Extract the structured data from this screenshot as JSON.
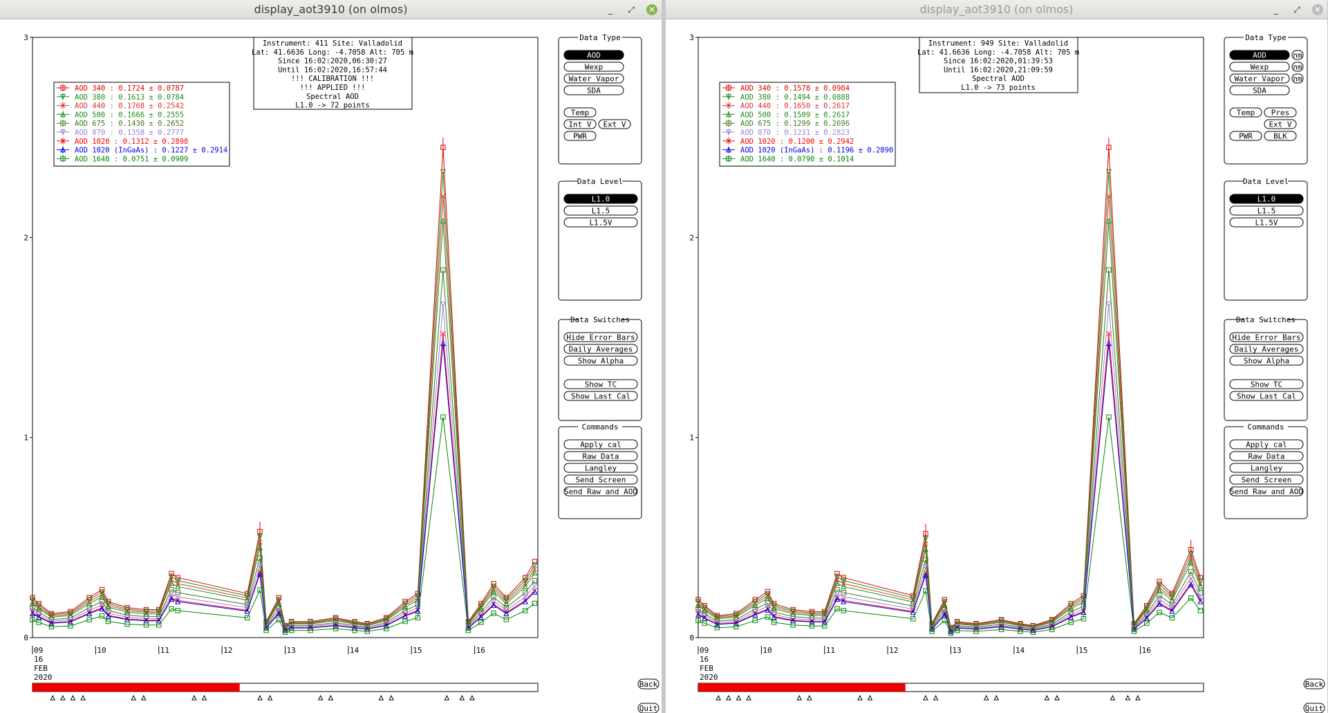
{
  "windows": [
    {
      "title": "display_aot3910 (on olmos)",
      "controls": {
        "minimize": "_",
        "maximize": "⤢",
        "close": "✕"
      },
      "info": [
        "Instrument: 411 Site: Valladolid",
        "Lat: 41.6636 Long: -4.7058 Alt: 705 m",
        "Since 16:02:2020,06:30:27",
        "Until 16:02:2020,16:57:44",
        "!!! CALIBRATION !!!",
        "!!!   APPLIED   !!!",
        "Spectral AOD",
        "L1.0 -> 72 points"
      ],
      "legend": [
        {
          "label": "AOD 340   : 0.1724 ± 0.0787",
          "color": "#e00000",
          "marker": "square"
        },
        {
          "label": "AOD 380   : 0.1613 ± 0.0784",
          "color": "#1a8c1a",
          "marker": "tri-down"
        },
        {
          "label": "AOD 440   : 0.1768 ± 0.2542",
          "color": "#e03030",
          "marker": "x"
        },
        {
          "label": "AOD 500   : 0.1666 ± 0.2555",
          "color": "#1a8c1a",
          "marker": "tri-up"
        },
        {
          "label": "AOD 675   : 0.1430 ± 0.2652",
          "color": "#3c7a1a",
          "marker": "square"
        },
        {
          "label": "AOD 870   : 0.1358 ± 0.2777",
          "color": "#9a80e0",
          "marker": "tri-down"
        },
        {
          "label": "AOD 1020  : 0.1312 ± 0.2898",
          "color": "#ff0000",
          "marker": "x"
        },
        {
          "label": "AOD 1020 (InGaAs)  : 0.1227 ± 0.2914",
          "color": "#0000ee",
          "marker": "tri-up"
        },
        {
          "label": "AOD 1640  : 0.0751 ± 0.0909",
          "color": "#008800",
          "marker": "square"
        }
      ],
      "y_ticks": [
        "3",
        "2",
        "1",
        "0"
      ],
      "x_ticks": [
        "09",
        "10",
        "11",
        "12",
        "13",
        "14",
        "15",
        "16"
      ],
      "date_lines": [
        "16",
        "FEB",
        "2020"
      ],
      "panels": [
        {
          "title": "Data Type",
          "buttons": [
            {
              "label": "AOD",
              "selected": true
            },
            {
              "label": "Wexp"
            },
            {
              "label": "Water Vapor"
            },
            {
              "label": "SDA"
            },
            {
              "label": "Temp"
            },
            {
              "label": "Int V"
            },
            {
              "label": "Ext V"
            },
            {
              "label": "PWR"
            }
          ]
        },
        {
          "title": "Data Level",
          "buttons": [
            {
              "label": "L1.0",
              "selected": true
            },
            {
              "label": "L1.5"
            },
            {
              "label": "L1.5V"
            }
          ]
        },
        {
          "title": "Data Switches",
          "buttons": [
            {
              "label": "Hide Error Bars"
            },
            {
              "label": "Daily Averages"
            },
            {
              "label": "Show Alpha"
            },
            {
              "label": "Show TC"
            },
            {
              "label": "Show Last Cal"
            }
          ]
        },
        {
          "title": "Commands",
          "buttons": [
            {
              "label": "Apply cal"
            },
            {
              "label": "Raw Data"
            },
            {
              "label": "Langley"
            },
            {
              "label": "Send Screen"
            },
            {
              "label": "Send Raw and AOD"
            }
          ]
        }
      ],
      "back_label": "Back",
      "quit_label": "Quit",
      "progress": 0.41
    },
    {
      "title": "display_aot3910 (on olmos)",
      "controls": {
        "minimize": "_",
        "maximize": "⤢",
        "close": "✕"
      },
      "info": [
        "Instrument: 949 Site: Valladolid",
        "Lat: 41.6636 Long: -4.7058 Alt: 705 m",
        "Since 16:02:2020,01:39:53",
        "Until 16:02:2020,21:09:59",
        "Spectral AOD",
        "L1.0 -> 73 points"
      ],
      "legend": [
        {
          "label": "AOD 340   : 0.1578 ± 0.0904",
          "color": "#e00000",
          "marker": "square"
        },
        {
          "label": "AOD 380   : 0.1494 ± 0.0888",
          "color": "#1a8c1a",
          "marker": "tri-down"
        },
        {
          "label": "AOD 440   : 0.1650 ± 0.2617",
          "color": "#e03030",
          "marker": "x"
        },
        {
          "label": "AOD 500   : 0.1509 ± 0.2617",
          "color": "#1a8c1a",
          "marker": "tri-up"
        },
        {
          "label": "AOD 675   : 0.1299 ± 0.2696",
          "color": "#3c7a1a",
          "marker": "square"
        },
        {
          "label": "AOD 870   : 0.1231 ± 0.2823",
          "color": "#9a80e0",
          "marker": "tri-down"
        },
        {
          "label": "AOD 1020  : 0.1200 ± 0.2942",
          "color": "#ff0000",
          "marker": "x"
        },
        {
          "label": "AOD 1020 (InGaAs)  : 0.1196 ± 0.2890",
          "color": "#0000ee",
          "marker": "tri-up"
        },
        {
          "label": "AOD 1640  : 0.0790 ± 0.1014",
          "color": "#008800",
          "marker": "square"
        }
      ],
      "y_ticks": [
        "3",
        "2",
        "1",
        "0"
      ],
      "x_ticks": [
        "09",
        "10",
        "11",
        "12",
        "13",
        "14",
        "15",
        "16"
      ],
      "date_lines": [
        "16",
        "FEB",
        "2020"
      ],
      "panels": [
        {
          "title": "Data Type",
          "buttons": [
            {
              "label": "AOD",
              "selected": true
            },
            {
              "label": "nm"
            },
            {
              "label": "Wexp"
            },
            {
              "label": "nm"
            },
            {
              "label": "Water Vapor"
            },
            {
              "label": "nm"
            },
            {
              "label": "SDA"
            },
            {
              "label": "Temp"
            },
            {
              "label": "Pres"
            },
            {
              "label": "Ext V"
            },
            {
              "label": "PWR"
            },
            {
              "label": "BLK"
            }
          ]
        },
        {
          "title": "Data Level",
          "buttons": [
            {
              "label": "L1.0",
              "selected": true
            },
            {
              "label": "L1.5"
            },
            {
              "label": "L1.5V"
            }
          ]
        },
        {
          "title": "Data Switches",
          "buttons": [
            {
              "label": "Hide Error Bars"
            },
            {
              "label": "Daily Averages"
            },
            {
              "label": "Show Alpha"
            },
            {
              "label": "Show TC"
            },
            {
              "label": "Show Last Cal"
            }
          ]
        },
        {
          "title": "Commands",
          "buttons": [
            {
              "label": "Apply cal"
            },
            {
              "label": "Raw Data"
            },
            {
              "label": "Langley"
            },
            {
              "label": "Send Screen"
            },
            {
              "label": "Send Raw and AOD"
            }
          ]
        }
      ],
      "back_label": "Back",
      "quit_label": "Quit",
      "progress": 0.41
    }
  ],
  "chart_data": [
    {
      "type": "line",
      "ylim": [
        0,
        3
      ],
      "x_axis": "day of FEB 2020",
      "xlim": [
        9,
        17
      ],
      "series_shape": {
        "x": [
          9.0,
          9.1,
          9.3,
          9.6,
          9.9,
          10.1,
          10.2,
          10.5,
          10.8,
          11.0,
          11.2,
          11.3,
          12.4,
          12.6,
          12.7,
          12.9,
          13.0,
          13.1,
          13.4,
          13.8,
          14.1,
          14.3,
          14.6,
          14.9,
          15.1,
          15.5,
          15.9,
          16.1,
          16.3,
          16.5,
          16.8,
          16.95
        ],
        "base": [
          0.2,
          0.17,
          0.12,
          0.13,
          0.2,
          0.24,
          0.18,
          0.15,
          0.14,
          0.14,
          0.32,
          0.3,
          0.22,
          0.53,
          0.08,
          0.2,
          0.06,
          0.08,
          0.08,
          0.1,
          0.08,
          0.07,
          0.1,
          0.18,
          0.22,
          2.45,
          0.08,
          0.17,
          0.27,
          0.2,
          0.3,
          0.38
        ]
      },
      "series": [
        {
          "name": "AOD 340",
          "scale": 1.0
        },
        {
          "name": "AOD 380",
          "scale": 0.95
        },
        {
          "name": "AOD 440",
          "scale": 0.9
        },
        {
          "name": "AOD 500",
          "scale": 0.85
        },
        {
          "name": "AOD 675",
          "scale": 0.75
        },
        {
          "name": "AOD 870",
          "scale": 0.68
        },
        {
          "name": "AOD 1020",
          "scale": 0.62
        },
        {
          "name": "AOD 1020 (InGaAs)",
          "scale": 0.6
        },
        {
          "name": "AOD 1640",
          "scale": 0.45
        }
      ]
    },
    {
      "type": "line",
      "ylim": [
        0,
        3
      ],
      "x_axis": "day of FEB 2020",
      "xlim": [
        9,
        17
      ],
      "series_shape": {
        "x": [
          9.0,
          9.1,
          9.3,
          9.6,
          9.9,
          10.1,
          10.2,
          10.5,
          10.8,
          11.0,
          11.2,
          11.3,
          12.4,
          12.6,
          12.7,
          12.9,
          13.0,
          13.1,
          13.4,
          13.8,
          14.1,
          14.3,
          14.6,
          14.9,
          15.1,
          15.5,
          15.9,
          16.1,
          16.3,
          16.5,
          16.8,
          16.95
        ],
        "base": [
          0.19,
          0.16,
          0.11,
          0.12,
          0.19,
          0.23,
          0.17,
          0.14,
          0.13,
          0.13,
          0.32,
          0.3,
          0.21,
          0.52,
          0.07,
          0.19,
          0.05,
          0.08,
          0.07,
          0.09,
          0.07,
          0.06,
          0.09,
          0.17,
          0.21,
          2.45,
          0.07,
          0.16,
          0.28,
          0.22,
          0.44,
          0.3
        ]
      },
      "series": [
        {
          "name": "AOD 340",
          "scale": 1.0
        },
        {
          "name": "AOD 380",
          "scale": 0.95
        },
        {
          "name": "AOD 440",
          "scale": 0.9
        },
        {
          "name": "AOD 500",
          "scale": 0.85
        },
        {
          "name": "AOD 675",
          "scale": 0.75
        },
        {
          "name": "AOD 870",
          "scale": 0.68
        },
        {
          "name": "AOD 1020",
          "scale": 0.62
        },
        {
          "name": "AOD 1020 (InGaAs)",
          "scale": 0.6
        },
        {
          "name": "AOD 1640",
          "scale": 0.45
        }
      ]
    }
  ]
}
